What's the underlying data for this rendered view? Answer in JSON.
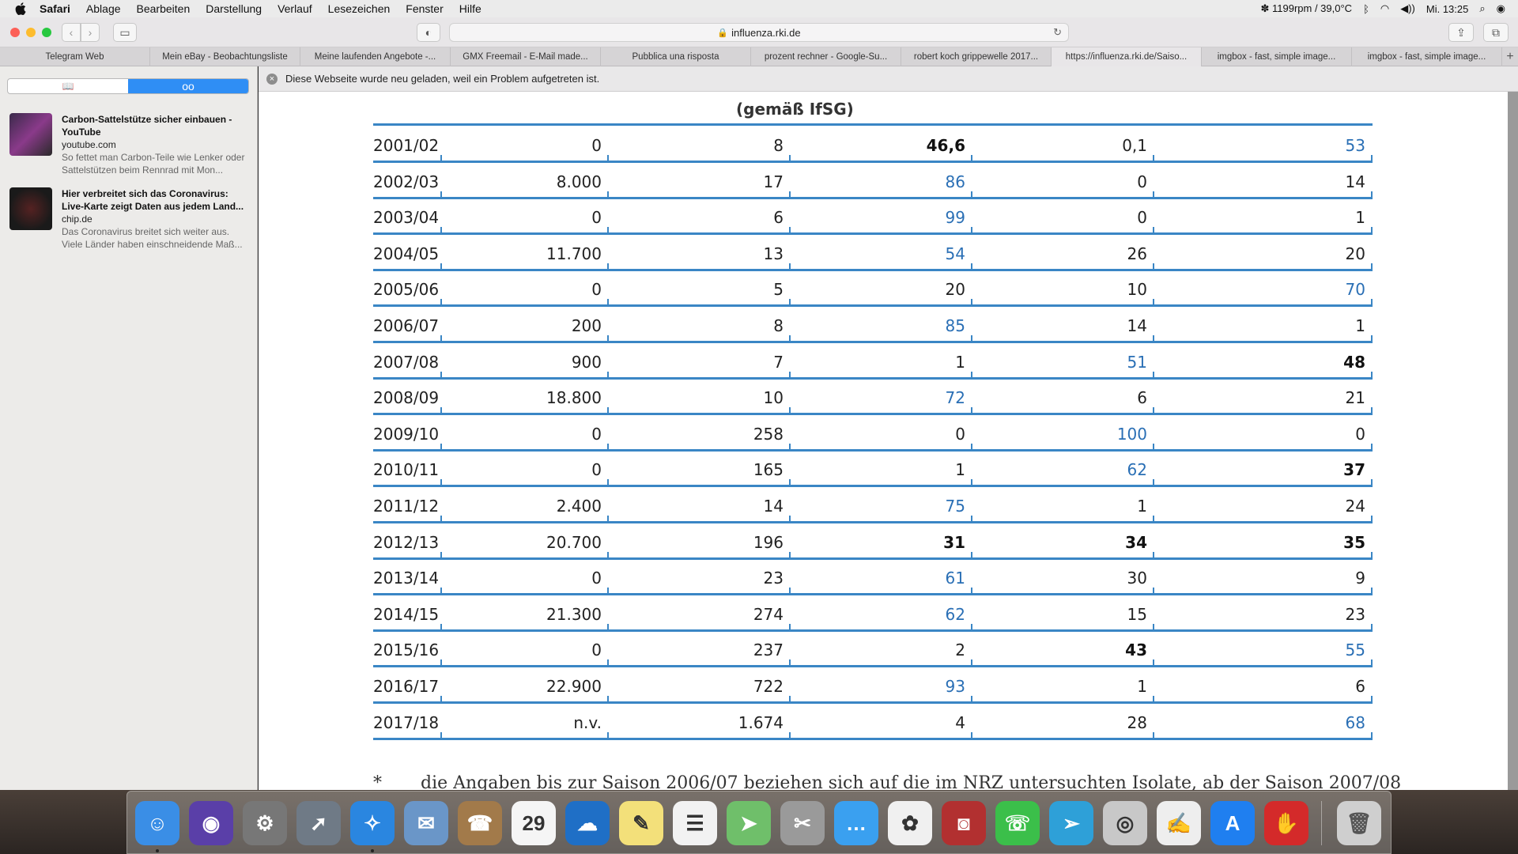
{
  "menubar": {
    "app": "Safari",
    "items": [
      "Ablage",
      "Bearbeiten",
      "Darstellung",
      "Verlauf",
      "Lesezeichen",
      "Fenster",
      "Hilfe"
    ],
    "status_fan": "1199rpm / 39,0°C",
    "clock": "Mi. 13:25",
    "icons": [
      "apple-icon",
      "fan-icon",
      "bluetooth-icon",
      "wifi-icon",
      "volume-icon",
      "search-icon",
      "user-icon"
    ]
  },
  "toolbar": {
    "url": "influenza.rki.de",
    "icons": [
      "back-icon",
      "forward-icon",
      "sidebar-icon",
      "privacy-icon",
      "lock-icon",
      "reload-icon",
      "share-icon",
      "tabs-overview-icon"
    ]
  },
  "tabs": [
    {
      "label": "Telegram Web",
      "active": false
    },
    {
      "label": "Mein eBay - Beobachtungsliste",
      "active": false
    },
    {
      "label": "Meine laufenden Angebote -...",
      "active": false
    },
    {
      "label": "GMX Freemail - E-Mail made...",
      "active": false
    },
    {
      "label": "Pubblica una risposta",
      "active": false
    },
    {
      "label": "prozent rechner - Google-Su...",
      "active": false
    },
    {
      "label": "robert koch grippewelle 2017...",
      "active": false
    },
    {
      "label": "https://influenza.rki.de/Saiso...",
      "active": true
    },
    {
      "label": "imgbox - fast, simple image...",
      "active": false
    },
    {
      "label": "imgbox - fast, simple image...",
      "active": false
    }
  ],
  "tab_add": "+",
  "sidebar": {
    "items": [
      {
        "title": "Carbon-Sattelstütze sicher einbauen - YouTube",
        "source": "youtube.com",
        "desc": "So fettet man Carbon-Teile wie Lenker oder Sattelstützen beim Rennrad mit Mon..."
      },
      {
        "title": "Hier verbreitet sich das Coronavirus: Live-Karte zeigt Daten aus jedem Land...",
        "source": "chip.de",
        "desc": "Das Coronavirus breitet sich weiter aus. Viele Länder haben einschneidende Maß..."
      }
    ]
  },
  "infobar": {
    "message": "Diese Webseite wurde neu geladen, weil ein Problem aufgetreten ist."
  },
  "table": {
    "header_fragment": "(gemäß IfSG)",
    "rows": [
      {
        "season": "2001/02",
        "cells": [
          {
            "v": "0",
            "s": ""
          },
          {
            "v": "8",
            "s": ""
          },
          {
            "v": "46,6",
            "s": "bold"
          },
          {
            "v": "0,1",
            "s": ""
          },
          {
            "v": "53",
            "s": "blue"
          }
        ]
      },
      {
        "season": "2002/03",
        "cells": [
          {
            "v": "8.000",
            "s": ""
          },
          {
            "v": "17",
            "s": ""
          },
          {
            "v": "86",
            "s": "blue"
          },
          {
            "v": "0",
            "s": ""
          },
          {
            "v": "14",
            "s": ""
          }
        ]
      },
      {
        "season": "2003/04",
        "cells": [
          {
            "v": "0",
            "s": ""
          },
          {
            "v": "6",
            "s": ""
          },
          {
            "v": "99",
            "s": "blue"
          },
          {
            "v": "0",
            "s": ""
          },
          {
            "v": "1",
            "s": ""
          }
        ]
      },
      {
        "season": "2004/05",
        "cells": [
          {
            "v": "11.700",
            "s": ""
          },
          {
            "v": "13",
            "s": ""
          },
          {
            "v": "54",
            "s": "blue"
          },
          {
            "v": "26",
            "s": ""
          },
          {
            "v": "20",
            "s": ""
          }
        ]
      },
      {
        "season": "2005/06",
        "cells": [
          {
            "v": "0",
            "s": ""
          },
          {
            "v": "5",
            "s": ""
          },
          {
            "v": "20",
            "s": ""
          },
          {
            "v": "10",
            "s": ""
          },
          {
            "v": "70",
            "s": "blue"
          }
        ]
      },
      {
        "season": "2006/07",
        "cells": [
          {
            "v": "200",
            "s": ""
          },
          {
            "v": "8",
            "s": ""
          },
          {
            "v": "85",
            "s": "blue"
          },
          {
            "v": "14",
            "s": ""
          },
          {
            "v": "1",
            "s": ""
          }
        ]
      },
      {
        "season": "2007/08",
        "cells": [
          {
            "v": "900",
            "s": ""
          },
          {
            "v": "7",
            "s": ""
          },
          {
            "v": "1",
            "s": ""
          },
          {
            "v": "51",
            "s": "blue"
          },
          {
            "v": "48",
            "s": "bold"
          }
        ]
      },
      {
        "season": "2008/09",
        "cells": [
          {
            "v": "18.800",
            "s": ""
          },
          {
            "v": "10",
            "s": ""
          },
          {
            "v": "72",
            "s": "blue"
          },
          {
            "v": "6",
            "s": ""
          },
          {
            "v": "21",
            "s": ""
          }
        ]
      },
      {
        "season": "2009/10",
        "cells": [
          {
            "v": "0",
            "s": ""
          },
          {
            "v": "258",
            "s": ""
          },
          {
            "v": "0",
            "s": ""
          },
          {
            "v": "100",
            "s": "blue"
          },
          {
            "v": "0",
            "s": ""
          }
        ]
      },
      {
        "season": "2010/11",
        "cells": [
          {
            "v": "0",
            "s": ""
          },
          {
            "v": "165",
            "s": ""
          },
          {
            "v": "1",
            "s": ""
          },
          {
            "v": "62",
            "s": "blue"
          },
          {
            "v": "37",
            "s": "bold"
          }
        ]
      },
      {
        "season": "2011/12",
        "cells": [
          {
            "v": "2.400",
            "s": ""
          },
          {
            "v": "14",
            "s": ""
          },
          {
            "v": "75",
            "s": "blue"
          },
          {
            "v": "1",
            "s": ""
          },
          {
            "v": "24",
            "s": ""
          }
        ]
      },
      {
        "season": "2012/13",
        "cells": [
          {
            "v": "20.700",
            "s": ""
          },
          {
            "v": "196",
            "s": ""
          },
          {
            "v": "31",
            "s": "bold"
          },
          {
            "v": "34",
            "s": "bold"
          },
          {
            "v": "35",
            "s": "bold"
          }
        ]
      },
      {
        "season": "2013/14",
        "cells": [
          {
            "v": "0",
            "s": ""
          },
          {
            "v": "23",
            "s": ""
          },
          {
            "v": "61",
            "s": "blue"
          },
          {
            "v": "30",
            "s": ""
          },
          {
            "v": "9",
            "s": ""
          }
        ]
      },
      {
        "season": "2014/15",
        "cells": [
          {
            "v": "21.300",
            "s": ""
          },
          {
            "v": "274",
            "s": ""
          },
          {
            "v": "62",
            "s": "blue"
          },
          {
            "v": "15",
            "s": ""
          },
          {
            "v": "23",
            "s": ""
          }
        ]
      },
      {
        "season": "2015/16",
        "cells": [
          {
            "v": "0",
            "s": ""
          },
          {
            "v": "237",
            "s": ""
          },
          {
            "v": "2",
            "s": ""
          },
          {
            "v": "43",
            "s": "bold"
          },
          {
            "v": "55",
            "s": "blue"
          }
        ]
      },
      {
        "season": "2016/17",
        "cells": [
          {
            "v": "22.900",
            "s": ""
          },
          {
            "v": "722",
            "s": ""
          },
          {
            "v": "93",
            "s": "blue"
          },
          {
            "v": "1",
            "s": ""
          },
          {
            "v": "6",
            "s": ""
          }
        ]
      },
      {
        "season": "2017/18",
        "cells": [
          {
            "v": "n.v.",
            "s": ""
          },
          {
            "v": "1.674",
            "s": ""
          },
          {
            "v": "4",
            "s": ""
          },
          {
            "v": "28",
            "s": ""
          },
          {
            "v": "68",
            "s": "blue"
          }
        ]
      }
    ],
    "footnote_marker": "*",
    "footnote": "die Angaben bis zur Saison 2006/07 beziehen sich auf die im NRZ untersuchten Isolate, ab der Saison 2007/08"
  },
  "colors": {
    "accent_blue": "#2a6fb5",
    "rule_blue": "#3a86c5",
    "sidebar_segment": "#2f8ef5"
  },
  "dock": {
    "apps": [
      {
        "name": "finder-icon",
        "glyph": "☺",
        "color": "#3a8ee6",
        "running": true
      },
      {
        "name": "siri-icon",
        "glyph": "◉",
        "color": "#5a3fa8",
        "running": false
      },
      {
        "name": "system-preferences-icon",
        "glyph": "⚙",
        "color": "#777777",
        "running": false
      },
      {
        "name": "launchpad-icon",
        "glyph": "➚",
        "color": "#6f7a86",
        "running": false
      },
      {
        "name": "safari-icon",
        "glyph": "✧",
        "color": "#2a86e0",
        "running": true
      },
      {
        "name": "mail-icon",
        "glyph": "✉",
        "color": "#6a96c8",
        "running": false
      },
      {
        "name": "contacts-icon",
        "glyph": "☎",
        "color": "#a27a4a",
        "running": false
      },
      {
        "name": "calendar-icon",
        "glyph": "29",
        "color": "#f5f5f5",
        "running": false
      },
      {
        "name": "openoffice-icon",
        "glyph": "☁",
        "color": "#1f6fc6",
        "running": false
      },
      {
        "name": "notes-icon",
        "glyph": "✎",
        "color": "#f3e07a",
        "running": false
      },
      {
        "name": "reminders-icon",
        "glyph": "☰",
        "color": "#f2f2f2",
        "running": false
      },
      {
        "name": "maps-icon",
        "glyph": "➤",
        "color": "#6fbf6a",
        "running": false
      },
      {
        "name": "screenshot-icon",
        "glyph": "✂",
        "color": "#9a9a9a",
        "running": false
      },
      {
        "name": "messages-icon",
        "glyph": "…",
        "color": "#3aa0f0",
        "running": false
      },
      {
        "name": "photos-icon",
        "glyph": "✿",
        "color": "#f0f0f0",
        "running": false
      },
      {
        "name": "photo-booth-icon",
        "glyph": "◙",
        "color": "#b23030",
        "running": false
      },
      {
        "name": "facetime-icon",
        "glyph": "☏",
        "color": "#3bbf4a",
        "running": false
      },
      {
        "name": "telegram-icon",
        "glyph": "➢",
        "color": "#2ea0d8",
        "running": false
      },
      {
        "name": "dvd-player-icon",
        "glyph": "◎",
        "color": "#c8c8c8",
        "running": false
      },
      {
        "name": "textedit-icon",
        "glyph": "✍",
        "color": "#eeeeee",
        "running": false
      },
      {
        "name": "app-store-icon",
        "glyph": "A",
        "color": "#1f7ff0",
        "running": false
      },
      {
        "name": "adblock-icon",
        "glyph": "✋",
        "color": "#d42a2a",
        "running": false
      }
    ],
    "trash": {
      "name": "trash-icon",
      "glyph": "🗑",
      "color": "#cfcfcf"
    }
  }
}
